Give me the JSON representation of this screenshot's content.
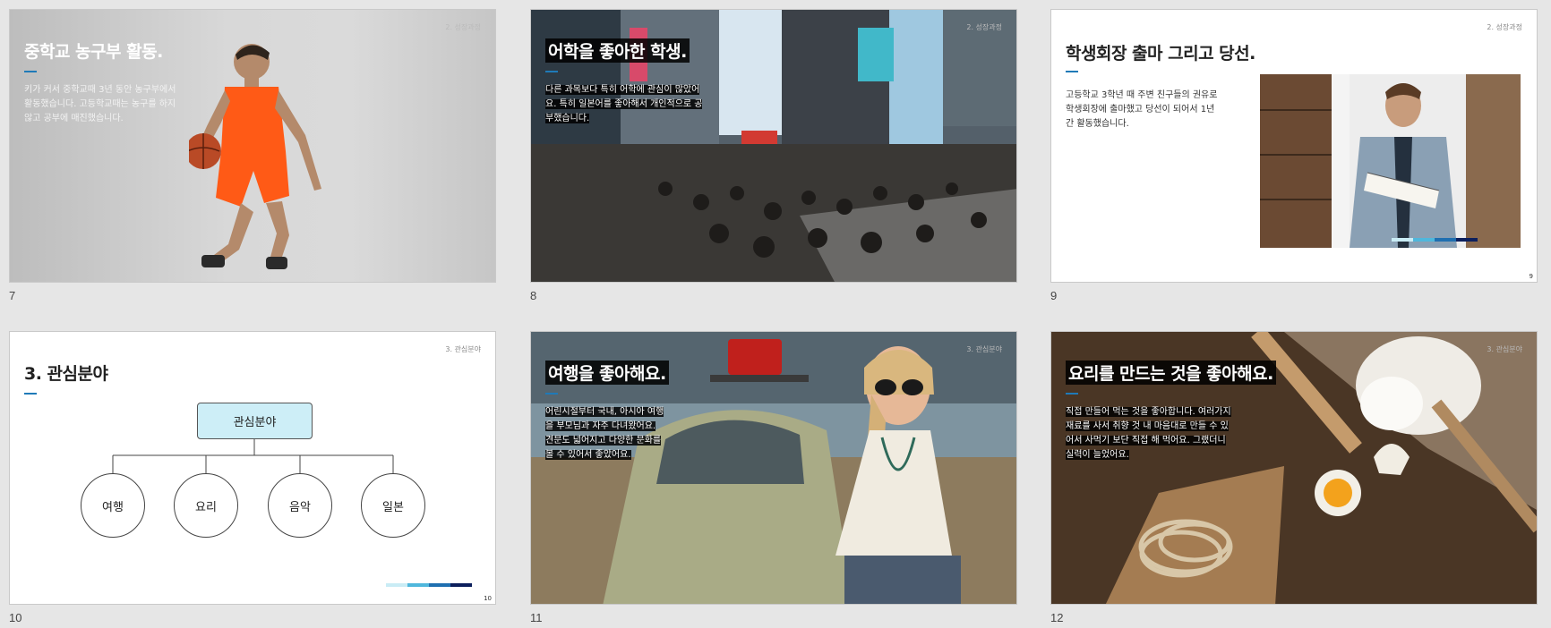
{
  "slides": [
    {
      "number": "7",
      "tag": "2. 성장과정",
      "title": "중학교 농구부 활동.",
      "body": [
        "키가 커서 중학교때 3년 동안 농구부에서",
        "활동했습니다. 고등학교때는 농구를 하지",
        "않고 공부에 매진했습니다."
      ]
    },
    {
      "number": "8",
      "tag": "2. 성장과정",
      "title": "어학을 좋아한 학생.",
      "body": [
        "다른 과목보다 특히 어학에 관심이 많았어",
        "요. 특히 일본어를 좋아해서 개인적으로 공",
        "부했습니다."
      ]
    },
    {
      "number": "9",
      "tag": "2. 성장과정",
      "title": "학생회장 출마 그리고 당선.",
      "body": [
        "고등학교 3학년 때 주변 친구들의 권유로",
        "학생회장에 출마했고 당선이 되어서 1년",
        "간 활동했습니다."
      ],
      "page": "9"
    },
    {
      "number": "10",
      "tag": "3. 관심분야",
      "title": "3. 관심분야",
      "root": "관심분야",
      "children": [
        "여행",
        "요리",
        "음악",
        "일본"
      ],
      "page": "10"
    },
    {
      "number": "11",
      "tag": "3. 관심분야",
      "title": "여행을 좋아해요.",
      "body": [
        "어린시절부터 국내, 아시아 여행",
        "을 부모님과 자주 다녀왔어요.",
        "견문도 넓어지고 다양한 문화를",
        "볼 수 있어서 좋았어요."
      ]
    },
    {
      "number": "12",
      "tag": "3. 관심분야",
      "title": "요리를 만드는 것을 좋아해요.",
      "body": [
        "직접 만들어 먹는 것을 좋아합니다. 여러가지",
        "재료를 사서 취향 것 내 마음대로 만들 수 있",
        "어서 사먹기 보단 직접 해 먹어요. 그랬더니",
        "실력이 늘었어요."
      ]
    }
  ],
  "colors": {
    "accent": "#1f7ab8",
    "bar1": "#c9ecf5",
    "bar2": "#4fb7dc",
    "bar3": "#1f6fb0",
    "bar4": "#0c1f5c"
  }
}
